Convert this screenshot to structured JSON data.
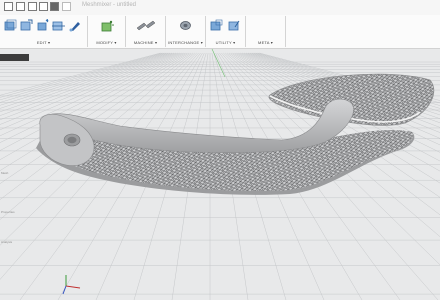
{
  "window": {
    "title": "Meshmixer - untitled"
  },
  "ribbon": {
    "groups": [
      {
        "label": "EDIT ▾"
      },
      {
        "label": "MODIFY ▾"
      },
      {
        "label": "MACHINE ▾"
      },
      {
        "label": "INTERCHANGE ▾"
      },
      {
        "label": "UTILITY ▾"
      },
      {
        "label": "META ▾"
      }
    ]
  },
  "side_panel": {
    "items": [
      {
        "label": "Mesh"
      },
      {
        "label": "Properties"
      },
      {
        "label": "Analysis"
      }
    ]
  },
  "colors": {
    "background": "#e8e9ea",
    "grid_line": "#c2c4c6",
    "model": "#b8b9bb",
    "lattice": "#5b5c5e",
    "ribbon_accent": "#3b7fc4"
  }
}
